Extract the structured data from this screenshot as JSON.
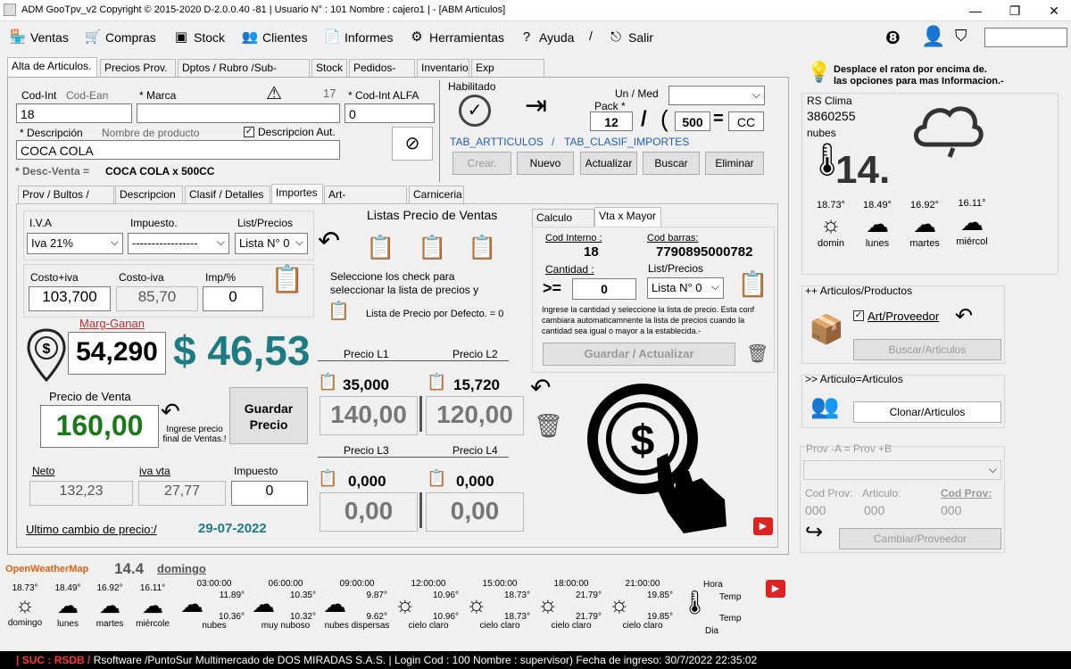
{
  "window": {
    "title": "ADM GooTpv_v2 Copyright ©  2015-2020 D-2.0.0.40 -81 | Usuario N° : 101 Nombre : cajero1 | - [ABM Articulos]"
  },
  "menu": [
    "Ventas",
    "Compras",
    "Stock",
    "Clientes",
    "Informes",
    "Herramientas",
    "Ayuda",
    "/",
    "Salir"
  ],
  "topTabs": [
    "Alta de Articulos.",
    "Precios Prov.",
    "Dptos / Rubro /Sub-Rubro:",
    "Stock",
    "Pedidos-Aut",
    "Inventario",
    "Exp Balanzas."
  ],
  "article": {
    "codIntLabel": "Cod-Int",
    "codEanLabel": "Cod-Ean",
    "codInt": "18",
    "marcaLabel": "* Marca",
    "marca": "",
    "warnCount": "17",
    "codAlfaLabel": "* Cod-Int ALFA",
    "codAlfa": "0",
    "descLabel": "* Descripción",
    "descPlaceholder": "Nombre de producto",
    "descAutLabel": "Descripcion Aut.",
    "desc": "COCA COLA",
    "descVentaLabel": "* Desc-Venta =",
    "descVenta": "COCA COLA   x 500CC"
  },
  "right": {
    "habilitado": "Habilitado",
    "unMed": "Un / Med",
    "pack": "Pack *",
    "pack1": "12",
    "pack2": "500",
    "unit": "CC",
    "tab1": "TAB_ARTTICULOS",
    "sep": "/",
    "tab2": "TAB_CLASIF_IMPORTES",
    "btns": [
      "Crear.",
      "Nuevo",
      "Actualizar",
      "Buscar",
      "Eliminar"
    ]
  },
  "subTabs": [
    "Prov / Bultos / EAN",
    "Descripcion",
    "Clasif / Detalles",
    "Importes",
    "Art-Combinados",
    "Carniceria"
  ],
  "importes": {
    "ivaLabel": "I.V.A",
    "iva": "Iva 21%",
    "impLabel": "Impuesto.",
    "imp": "-----------------",
    "listLabel": "List/Precios",
    "list": "Lista N° 0",
    "costoIvaLabel": "Costo+iva",
    "costoIva": "103,700",
    "costoLabel": "Costo-iva",
    "costo": "85,70",
    "impPctLabel": "Imp/%",
    "impPct": "0",
    "margLabel": "Marg-Ganan",
    "marg": "54,290",
    "margDollar": "$ 46,53",
    "pvLabel": "Precio de Venta",
    "pv": "160,00",
    "ingreseLabel": "Ingrese precio final de Ventas.!",
    "guardar": "Guardar Precio",
    "netoLabel": "Neto",
    "neto": "132,23",
    "ivaVtaLabel": "iva vta",
    "ivaVta": "27,77",
    "impuestoLabel": "Impuesto",
    "impuesto": "0",
    "ultimoLabel": "Ultimo cambio de precio:/",
    "ultimo": "29-07-2022"
  },
  "listas": {
    "title": "Listas Precio de Ventas",
    "info": "Seleccione los check para seleccionar la lista de precios y grabar el precio.",
    "defLabel": "Lista de Precio por Defecto. = 0",
    "items": [
      {
        "label": "Precio L1",
        "small": "35,000",
        "big": "140,00"
      },
      {
        "label": "Precio L2",
        "small": "15,720",
        "big": "120,00"
      },
      {
        "label": "Precio L3",
        "small": "0,000",
        "big": "0,00"
      },
      {
        "label": "Precio L4",
        "small": "0,000",
        "big": "0,00"
      }
    ]
  },
  "mayor": {
    "tabs": [
      "Calculo IVA",
      "Vta x Mayor"
    ],
    "codIntLabel": "Cod Interno :",
    "codInt": "18",
    "codBarLabel": "Cod barras:",
    "codBar": "7790895000782",
    "cantLabel": "Cantidad :",
    "cantOp": ">=",
    "cant": "0",
    "listLabel": "List/Precios",
    "list": "Lista N° 0",
    "info": "Ingrese la cantidad y seleccione la lista de precio. Esta conf cambiara automaticamnente la lista de precios cuando la cantidad sea igual o mayor a la establecida.-",
    "guardar": "Guardar / Actualizar"
  },
  "help": {
    "line1": "Desplace el raton por encima de.",
    "line2": "las opciones para mas Informacion.-"
  },
  "clima": {
    "title": "RS Clima",
    "code": "3860255",
    "desc": "nubes",
    "temp": "14.",
    "days": [
      {
        "t": "18.73°",
        "d": "domin"
      },
      {
        "t": "18.49°",
        "d": "lunes"
      },
      {
        "t": "16.92°",
        "d": "martes"
      },
      {
        "t": "16.11°",
        "d": "miércol"
      }
    ]
  },
  "artProv": {
    "title": "++ Articulos/Productos",
    "check": "Art/Proveedor",
    "btn": "Buscar/Articulos"
  },
  "artArt": {
    "title": ">> Articulo=Articulos",
    "btn": "Clonar/Articulos"
  },
  "provAB": {
    "title": "Prov -A = Prov +B",
    "codProv": "Cod Prov:",
    "articulo": "Articulo:",
    "codProv2": "Cod Prov:",
    "v1": "000",
    "v2": "000",
    "v3": "000",
    "btn": "Cambiar/Proveedor"
  },
  "owm": {
    "brand": "OpenWeatherMap",
    "temp": "14.4",
    "day": "domingo",
    "days": [
      {
        "t": "18.73°",
        "d": "domingo"
      },
      {
        "t": "18.49°",
        "d": "lunes"
      },
      {
        "t": "16.92°",
        "d": "martes"
      },
      {
        "t": "16.11°",
        "d": "miércole"
      }
    ],
    "hours": [
      {
        "h": "03:00:00",
        "a": "11.89°",
        "b": "10.36°",
        "d": "nubes"
      },
      {
        "h": "06:00:00",
        "a": "10.35°",
        "b": "10.32°",
        "d": "muy nuboso"
      },
      {
        "h": "09:00:00",
        "a": "9.87°",
        "b": "9.62°",
        "d": "nubes dispersas"
      },
      {
        "h": "12:00:00",
        "a": "10.96°",
        "b": "10.96°",
        "d": "cielo claro"
      },
      {
        "h": "15:00:00",
        "a": "18.73°",
        "b": "18.73°",
        "d": "cielo claro"
      },
      {
        "h": "18:00:00",
        "a": "21.79°",
        "b": "21.79°",
        "d": "cielo claro"
      },
      {
        "h": "21:00:00",
        "a": "19.85°",
        "b": "19.85°",
        "d": "cielo claro"
      }
    ],
    "hora": "Hora",
    "temp1": "Temp",
    "temp2": "Temp",
    "dia": "Dia"
  },
  "status": {
    "suc": "| SUC : RSDB /",
    "text": "Rsoftware /PuntoSur Multimercado de DOS MIRADAS S.A.S. | Login Cod : 100 Nombre : supervisor) Fecha de ingreso: 30/7/2022 22:35:02"
  }
}
